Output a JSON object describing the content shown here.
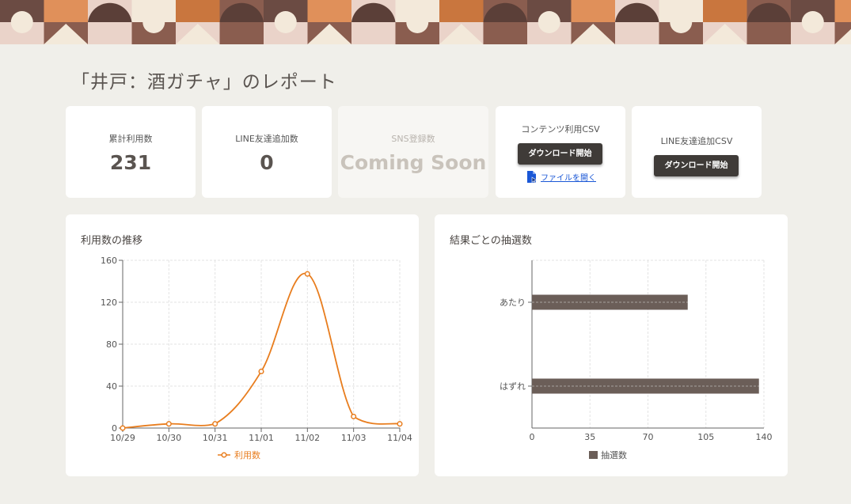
{
  "page": {
    "title": "「井戸：酒ガチャ」のレポート"
  },
  "stats": [
    {
      "label": "累計利用数",
      "value": "231"
    },
    {
      "label": "LINE友達追加数",
      "value": "0"
    },
    {
      "label": "SNS登録数",
      "value": "Coming Soon"
    }
  ],
  "csv_cards": [
    {
      "label": "コンテンツ利用CSV",
      "button": "ダウンロード開始",
      "link": "ファイルを開く"
    },
    {
      "label": "LINE友達追加CSV",
      "button": "ダウンロード開始"
    }
  ],
  "colors": {
    "line": "#e87d1e",
    "bar": "#6b5e58",
    "accent_link": "#1a57d6"
  },
  "chart_data": [
    {
      "type": "line",
      "title": "利用数の推移",
      "x": [
        "10/29",
        "10/30",
        "10/31",
        "11/01",
        "11/02",
        "11/03",
        "11/04"
      ],
      "series": [
        {
          "name": "利用数",
          "values": [
            0,
            4,
            4,
            54,
            147,
            11,
            4
          ]
        }
      ],
      "ylim": [
        0,
        160
      ],
      "yticks": [
        0,
        40,
        80,
        120,
        160
      ],
      "grid": true,
      "legend": "bottom"
    },
    {
      "type": "bar",
      "orientation": "horizontal",
      "title": "結果ごとの抽選数",
      "categories": [
        "あたり",
        "はずれ"
      ],
      "series": [
        {
          "name": "抽選数",
          "values": [
            94,
            137
          ]
        }
      ],
      "xlim": [
        0,
        140
      ],
      "xticks": [
        0,
        35,
        70,
        105,
        140
      ],
      "grid": true,
      "legend": "bottom"
    }
  ]
}
